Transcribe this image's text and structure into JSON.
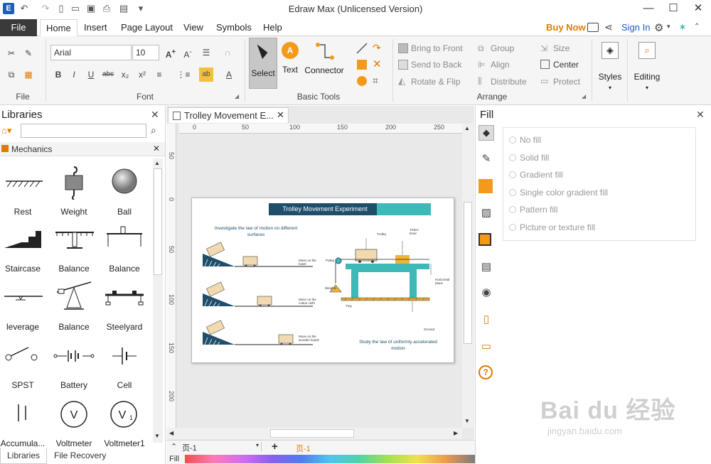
{
  "app": {
    "title": "Edraw Max (Unlicensed Version)"
  },
  "menu": {
    "file": "File",
    "home": "Home",
    "insert": "Insert",
    "page_layout": "Page Layout",
    "view": "View",
    "symbols": "Symbols",
    "help": "Help",
    "buy_now": "Buy Now",
    "sign_in": "Sign In"
  },
  "ribbon": {
    "font_name": "Arial",
    "font_size": "10",
    "groups": {
      "file": "File",
      "font": "Font",
      "basic_tools": "Basic Tools",
      "arrange": "Arrange"
    },
    "tools": {
      "select": "Select",
      "text": "Text",
      "connector": "Connector"
    },
    "arrange": {
      "bring_to_front": "Bring to Front",
      "send_to_back": "Send to Back",
      "rotate_flip": "Rotate & Flip",
      "group": "Group",
      "align": "Align",
      "distribute": "Distribute",
      "size": "Size",
      "center": "Center",
      "protect": "Protect"
    },
    "styles": "Styles",
    "editing": "Editing"
  },
  "libraries": {
    "title": "Libraries",
    "category": "Mechanics",
    "shapes": [
      "Rest",
      "Weight",
      "Ball",
      "Staircase",
      "Balance",
      "Balance",
      "leverage",
      "Balance",
      "Steelyard",
      "SPST",
      "Battery",
      "Cell",
      "Accumula...",
      "Voltmeter",
      "Voltmeter1"
    ],
    "tabs": {
      "libraries": "Libraries",
      "file_recovery": "File Recovery"
    }
  },
  "document": {
    "tab_title": "Trolley Movement E...",
    "ruler_h": [
      "0",
      "50",
      "100",
      "150",
      "200",
      "250"
    ],
    "ruler_v": [
      "50",
      "0",
      "50",
      "100",
      "150",
      "200"
    ],
    "diagram": {
      "title": "Trolley Movement Experiment",
      "left_heading": "Investigate the law of motion on different surfaces",
      "surface_labels": [
        "Move on the towel",
        "Move on the cotton cloth",
        "Move on the wooden board"
      ],
      "right_labels": {
        "trolley": "Trolley",
        "ticker_timer": "Ticker-timer",
        "pulley": "Pulley",
        "weights": "Weights",
        "tray": "Tray",
        "horizontal_plane": "Horizontal plane",
        "ground": "Ground"
      },
      "right_caption": "Study the law of uniformly accelerated motion"
    }
  },
  "fill_panel": {
    "title": "Fill",
    "options": [
      "No fill",
      "Solid fill",
      "Gradient fill",
      "Single color gradient fill",
      "Pattern fill",
      "Picture or texture fill"
    ]
  },
  "status": {
    "page_select": "页-1",
    "page_tab": "页-1",
    "fill_label": "Fill"
  },
  "watermark": {
    "text": "Bai du 经验",
    "url": "jingyan.baidu.com"
  },
  "colors": {
    "accent": "#e07b00",
    "teal": "#3fb8b8",
    "navy": "#1f4e6b",
    "selected_tool": "#c7c7c7"
  }
}
